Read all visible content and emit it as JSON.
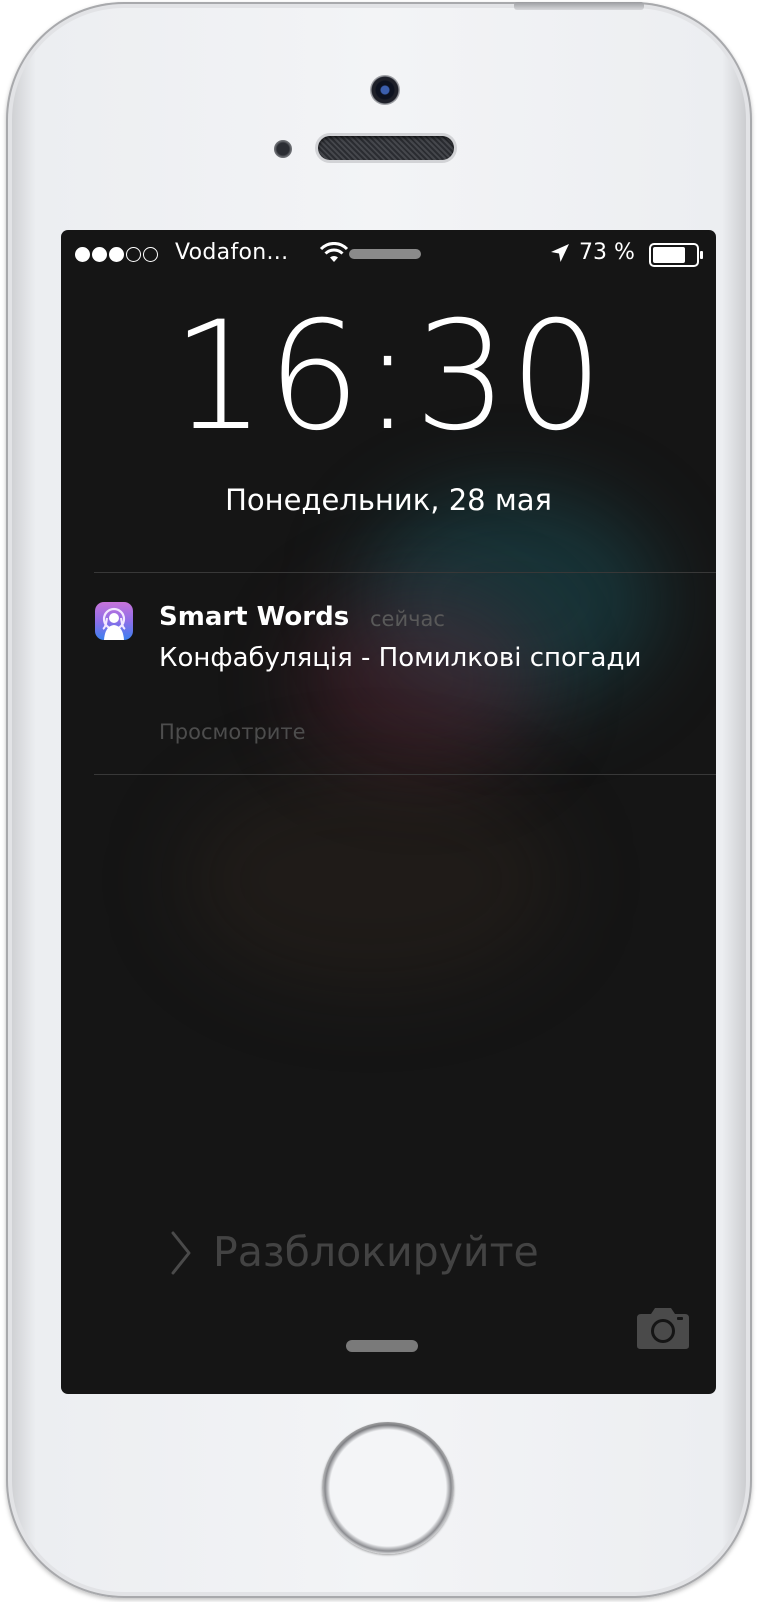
{
  "status_bar": {
    "carrier": "Vodafon...",
    "battery_percent": "73 %",
    "signal_bars_filled": 3,
    "signal_bars_total": 5
  },
  "lock_screen": {
    "time": "16:30",
    "date": "Понедельник, 28 мая",
    "unlock_hint": "Разблокируйте"
  },
  "notification": {
    "app_name": "Smart Words",
    "time": "сейчас",
    "message": "Конфабуляція - Помилкові спогади",
    "action": "Просмотрите"
  },
  "icons": {
    "wifi": "wifi-icon",
    "location": "location-arrow-icon",
    "battery": "battery-icon",
    "camera": "camera-icon",
    "chevron": "chevron-right-icon",
    "app": "smart-words-app-icon"
  },
  "colors": {
    "screen_background": "#151515",
    "notification_secondary": "#595959",
    "unlock_hint": "#434343",
    "app_icon_top": "#c774d9",
    "app_icon_bottom": "#3b80ef"
  }
}
